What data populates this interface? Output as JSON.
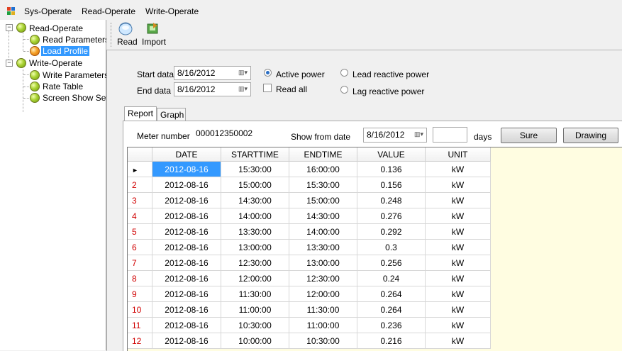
{
  "menu": {
    "items": [
      "Sys-Operate",
      "Read-Operate",
      "Write-Operate"
    ]
  },
  "tree": {
    "read_operate": "Read-Operate",
    "read_parameters": "Read Parameters",
    "load_profile": "Load Profile",
    "write_operate": "Write-Operate",
    "write_parameters": "Write Parameters",
    "rate_table": "Rate Table",
    "screen_show_set": "Screen Show Set"
  },
  "toolbar": {
    "read": "Read",
    "import": "Import"
  },
  "filters": {
    "start_label": "Start data",
    "start_value": "8/16/2012",
    "end_label": "End data",
    "end_value": "8/16/2012",
    "active_power": "Active power",
    "read_all": "Read all",
    "lead_reactive": "Lead reactive power",
    "lag_reactive": "Lag reactive power"
  },
  "tabs": {
    "report": "Report",
    "graph": "Graph"
  },
  "report": {
    "meter_label": "Meter number",
    "meter_value": "000012350002",
    "show_from_label": "Show from date",
    "show_from_value": "8/16/2012",
    "days_value": "",
    "days_label": "days",
    "sure": "Sure",
    "drawing": "Drawing"
  },
  "grid": {
    "columns": [
      "DATE",
      "STARTTIME",
      "ENDTIME",
      "VALUE",
      "UNIT"
    ],
    "rows": [
      {
        "n": "",
        "cells": [
          "2012-08-16",
          "15:30:00",
          "16:00:00",
          "0.136",
          "kW"
        ]
      },
      {
        "n": "2",
        "cells": [
          "2012-08-16",
          "15:00:00",
          "15:30:00",
          "0.156",
          "kW"
        ]
      },
      {
        "n": "3",
        "cells": [
          "2012-08-16",
          "14:30:00",
          "15:00:00",
          "0.248",
          "kW"
        ]
      },
      {
        "n": "4",
        "cells": [
          "2012-08-16",
          "14:00:00",
          "14:30:00",
          "0.276",
          "kW"
        ]
      },
      {
        "n": "5",
        "cells": [
          "2012-08-16",
          "13:30:00",
          "14:00:00",
          "0.292",
          "kW"
        ]
      },
      {
        "n": "6",
        "cells": [
          "2012-08-16",
          "13:00:00",
          "13:30:00",
          "0.3",
          "kW"
        ]
      },
      {
        "n": "7",
        "cells": [
          "2012-08-16",
          "12:30:00",
          "13:00:00",
          "0.256",
          "kW"
        ]
      },
      {
        "n": "8",
        "cells": [
          "2012-08-16",
          "12:00:00",
          "12:30:00",
          "0.24",
          "kW"
        ]
      },
      {
        "n": "9",
        "cells": [
          "2012-08-16",
          "11:30:00",
          "12:00:00",
          "0.264",
          "kW"
        ]
      },
      {
        "n": "10",
        "cells": [
          "2012-08-16",
          "11:00:00",
          "11:30:00",
          "0.264",
          "kW"
        ]
      },
      {
        "n": "11",
        "cells": [
          "2012-08-16",
          "10:30:00",
          "11:00:00",
          "0.236",
          "kW"
        ]
      },
      {
        "n": "12",
        "cells": [
          "2012-08-16",
          "10:00:00",
          "10:30:00",
          "0.216",
          "kW"
        ]
      }
    ]
  },
  "colors": {
    "selection": "#3399ff",
    "row_number": "#d00000",
    "grid_empty": "#fffde1"
  }
}
